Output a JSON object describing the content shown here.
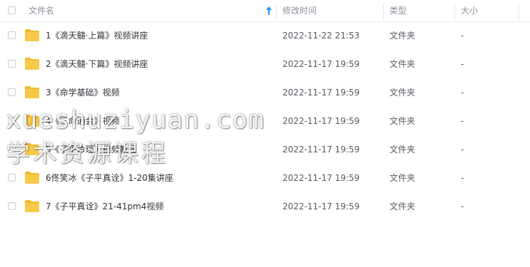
{
  "header": {
    "name_label": "文件名",
    "time_label": "修改时间",
    "type_label": "类型",
    "size_label": "大小"
  },
  "rows": [
    {
      "name": "1《滴天髓·上篇》视频讲座",
      "time": "2022-11-22 21:53",
      "type": "文件夹",
      "size": "-"
    },
    {
      "name": "2《滴天髓·下篇》视频讲座",
      "time": "2022-11-17 19:59",
      "type": "文件夹",
      "size": "-"
    },
    {
      "name": "3《命学基础》视频",
      "time": "2022-11-17 19:59",
      "type": "文件夹",
      "size": "-"
    },
    {
      "name": "4《三命通会》视频",
      "time": "2022-11-17 19:59",
      "type": "文件夹",
      "size": "-"
    },
    {
      "name": "5《子平命理》视频教程",
      "time": "2022-11-17 19:59",
      "type": "文件夹",
      "size": "-"
    },
    {
      "name": "6佟笑冰《子平真诠》1-20集讲座",
      "time": "2022-11-17 19:59",
      "type": "文件夹",
      "size": "-"
    },
    {
      "name": "7《子平真诠》21-41pm4视频",
      "time": "2022-11-17 19:59",
      "type": "文件夹",
      "size": "-"
    }
  ],
  "watermark": {
    "line1": "xueshuziyuan.com",
    "line2": "学术资源课程"
  },
  "colors": {
    "folder": "#f7c948",
    "folder_tab": "#f2b92e",
    "sort_arrow": "#1e90ff"
  },
  "icons": {
    "sort": "arrow-up-icon",
    "folder": "folder-icon",
    "checkbox": "checkbox-icon"
  }
}
